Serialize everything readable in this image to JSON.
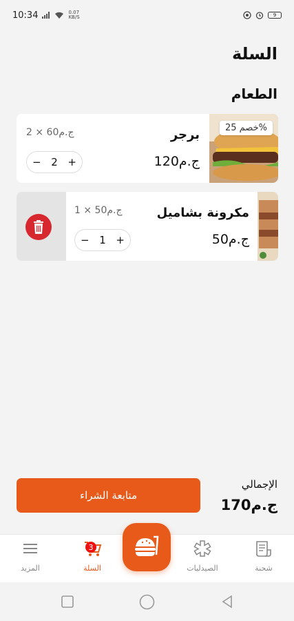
{
  "status_bar": {
    "time": "10:34",
    "net_speed_value": "0.07",
    "net_speed_unit": "KB/S",
    "battery": "9"
  },
  "page": {
    "title": "السلة",
    "section_title": "الطعام"
  },
  "cart_items": [
    {
      "name": "برجر",
      "unit_line": "2 × 60ج.م",
      "total": "120ج.م",
      "quantity": "2",
      "discount_badge": "خصم 25%",
      "image_icon": "burger-photo"
    },
    {
      "name": "مكرونة بشاميل",
      "unit_line": "1 × 50ج.م",
      "total": "50ج.م",
      "quantity": "1",
      "image_icon": "pasta-photo"
    }
  ],
  "summary": {
    "total_label": "الإجمالي",
    "total_value": "170ج.م",
    "checkout_label": "متابعة الشراء"
  },
  "bottom_nav": {
    "items": [
      {
        "label": "شحنة",
        "icon": "receipt-icon"
      },
      {
        "label": "الصيدليات",
        "icon": "medical-icon"
      },
      {
        "label": "",
        "icon": "food-fab-icon"
      },
      {
        "label": "السلة",
        "icon": "cart-icon",
        "badge": "3"
      },
      {
        "label": "المزيد",
        "icon": "menu-icon"
      }
    ]
  },
  "colors": {
    "accent": "#e85a1a",
    "danger": "#d8282f",
    "background": "#f3f3f3"
  }
}
